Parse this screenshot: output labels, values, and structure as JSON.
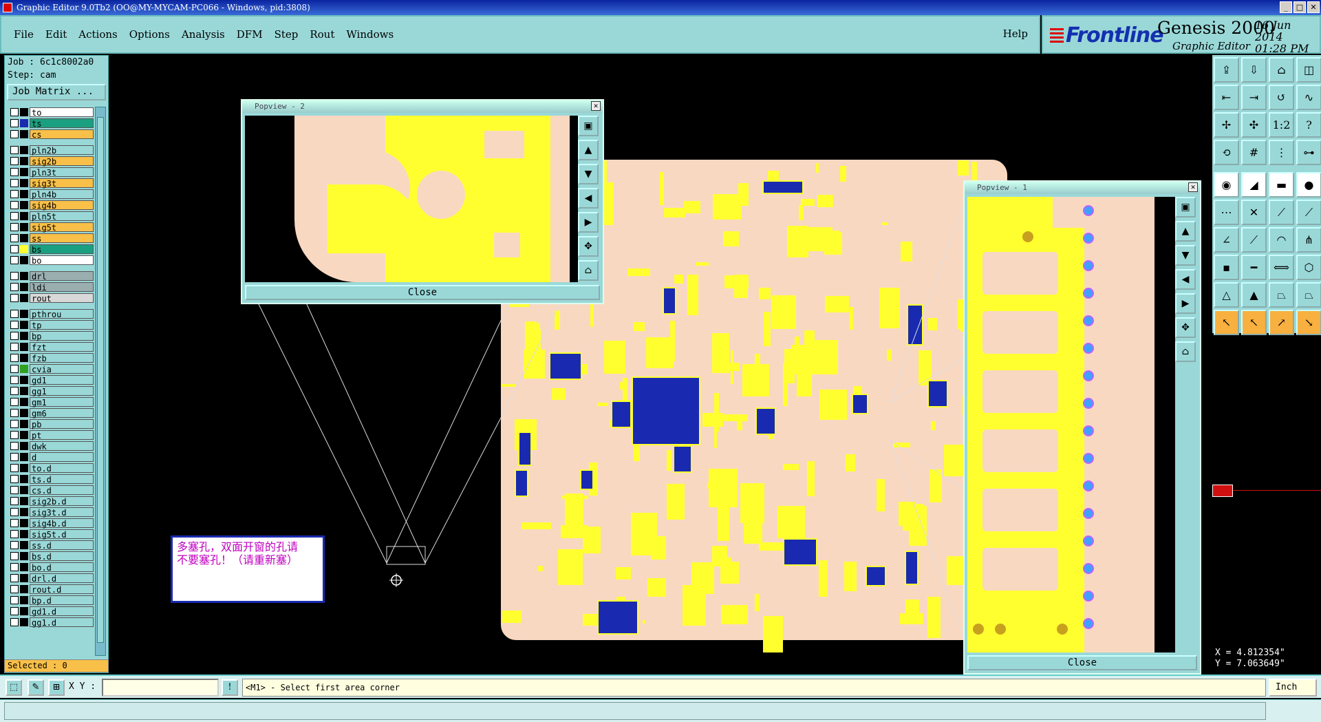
{
  "window": {
    "title": "Graphic Editor 9.0Tb2 (OO@MY-MYCAM-PC066 - Windows, pid:3808)"
  },
  "menu": {
    "items": [
      "File",
      "Edit",
      "Actions",
      "Options",
      "Analysis",
      "DFM",
      "Step",
      "Rout",
      "Windows"
    ],
    "help": "Help"
  },
  "brand": {
    "logo": "Frontline",
    "product": "Genesis 2000",
    "subtitle": "Graphic Editor",
    "date": "16 Jun 2014",
    "time": "01:28 PM"
  },
  "job": {
    "job": "Job : 6c1c8002a0",
    "step": "Step: cam",
    "matrix_button": "Job Matrix ..."
  },
  "layers": [
    {
      "name": "to",
      "color": "#ffffff",
      "sw": "#000000"
    },
    {
      "name": "ts",
      "color": "#1aa080",
      "sw": "#1a2ab0"
    },
    {
      "name": "cs",
      "color": "#f8c048",
      "sw": "#000000"
    },
    {
      "name": "pln2b",
      "color": "#9ad8d8",
      "sw": "#000000",
      "sep": true
    },
    {
      "name": "sig2b",
      "color": "#f8c048",
      "sw": "#000000"
    },
    {
      "name": "pln3t",
      "color": "#9ad8d8",
      "sw": "#000000"
    },
    {
      "name": "sig3t",
      "color": "#f8c048",
      "sw": "#000000"
    },
    {
      "name": "pln4b",
      "color": "#9ad8d8",
      "sw": "#000000"
    },
    {
      "name": "sig4b",
      "color": "#f8c048",
      "sw": "#000000"
    },
    {
      "name": "pln5t",
      "color": "#9ad8d8",
      "sw": "#000000"
    },
    {
      "name": "sig5t",
      "color": "#f8c048",
      "sw": "#000000"
    },
    {
      "name": "ss",
      "color": "#f8c048",
      "sw": "#000000"
    },
    {
      "name": "bs",
      "color": "#1aa080",
      "sw": "#ffff30"
    },
    {
      "name": "bo",
      "color": "#ffffff",
      "sw": "#000000"
    },
    {
      "name": "drl",
      "color": "#9aaeb0",
      "sw": "#000000",
      "sep": true
    },
    {
      "name": "ldi",
      "color": "#9aaeb0",
      "sw": "#000000"
    },
    {
      "name": "rout",
      "color": "#d8d8d8",
      "sw": "#000000"
    },
    {
      "name": "pthrou",
      "color": "#9ad8d8",
      "sw": "#000000",
      "sep": true
    },
    {
      "name": "tp",
      "color": "#9ad8d8",
      "sw": "#000000"
    },
    {
      "name": "bp",
      "color": "#9ad8d8",
      "sw": "#000000"
    },
    {
      "name": "fzt",
      "color": "#9ad8d8",
      "sw": "#000000"
    },
    {
      "name": "fzb",
      "color": "#9ad8d8",
      "sw": "#000000"
    },
    {
      "name": "cvia",
      "color": "#9ad8d8",
      "sw": "#30a020"
    },
    {
      "name": "gd1",
      "color": "#9ad8d8",
      "sw": "#000000"
    },
    {
      "name": "gg1",
      "color": "#9ad8d8",
      "sw": "#000000"
    },
    {
      "name": "gm1",
      "color": "#9ad8d8",
      "sw": "#000000"
    },
    {
      "name": "gm6",
      "color": "#9ad8d8",
      "sw": "#000000"
    },
    {
      "name": "pb",
      "color": "#9ad8d8",
      "sw": "#000000"
    },
    {
      "name": "pt",
      "color": "#9ad8d8",
      "sw": "#000000"
    },
    {
      "name": "dwk",
      "color": "#9ad8d8",
      "sw": "#000000"
    },
    {
      "name": "d",
      "color": "#9ad8d8",
      "sw": "#000000"
    },
    {
      "name": "to.d",
      "color": "#9ad8d8",
      "sw": "#000000"
    },
    {
      "name": "ts.d",
      "color": "#9ad8d8",
      "sw": "#000000"
    },
    {
      "name": "cs.d",
      "color": "#9ad8d8",
      "sw": "#000000"
    },
    {
      "name": "sig2b.d",
      "color": "#9ad8d8",
      "sw": "#000000"
    },
    {
      "name": "sig3t.d",
      "color": "#9ad8d8",
      "sw": "#000000"
    },
    {
      "name": "sig4b.d",
      "color": "#9ad8d8",
      "sw": "#000000"
    },
    {
      "name": "sig5t.d",
      "color": "#9ad8d8",
      "sw": "#000000"
    },
    {
      "name": "ss.d",
      "color": "#9ad8d8",
      "sw": "#000000"
    },
    {
      "name": "bs.d",
      "color": "#9ad8d8",
      "sw": "#000000"
    },
    {
      "name": "bo.d",
      "color": "#9ad8d8",
      "sw": "#000000"
    },
    {
      "name": "drl.d",
      "color": "#9ad8d8",
      "sw": "#000000"
    },
    {
      "name": "rout.d",
      "color": "#9ad8d8",
      "sw": "#000000"
    },
    {
      "name": "bp.d",
      "color": "#9ad8d8",
      "sw": "#000000"
    },
    {
      "name": "gd1.d",
      "color": "#9ad8d8",
      "sw": "#000000"
    },
    {
      "name": "gg1.d",
      "color": "#9ad8d8",
      "sw": "#000000"
    }
  ],
  "selected": "Selected : 0",
  "note": {
    "line1": "多塞孔，双面开窗的孔请",
    "line2": "不要塞孔！（请重新塞）"
  },
  "popview2": {
    "title": "Popview - 2",
    "close": "Close"
  },
  "popview1": {
    "title": "Popview - 1",
    "close": "Close"
  },
  "coords": {
    "x": "X = 4.812354\"",
    "y": "Y = 7.063649\""
  },
  "cmdbar": {
    "xy_label": "X Y :",
    "xy_value": "",
    "message": "<M1> - Select first area corner",
    "unit": "Inch"
  },
  "colors": {
    "board": "#f9d8c2",
    "copper": "#ffff30",
    "component": "#1a2ab0",
    "panel": "#9ad8d8",
    "highlight": "#f8b040"
  }
}
